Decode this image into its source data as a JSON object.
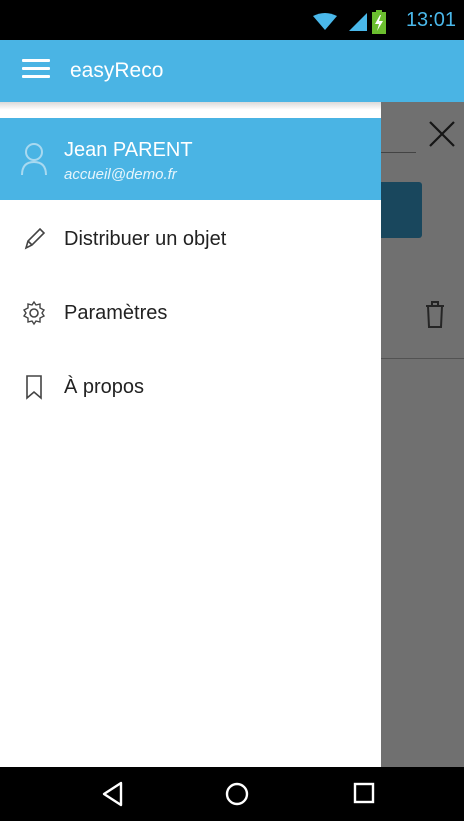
{
  "status_bar": {
    "time": "13:01",
    "icons": [
      "wifi-icon",
      "signal-icon",
      "battery-charging-icon"
    ],
    "clock_color": "#4ab8ea"
  },
  "app_bar": {
    "menu_icon": "hamburger-menu-icon",
    "title": "easyReco",
    "color": "#4ab4e4"
  },
  "drawer": {
    "header": {
      "avatar_icon": "person-icon",
      "name": "Jean PARENT",
      "email": "accueil@demo.fr"
    },
    "items": [
      {
        "icon": "pencil-icon",
        "label": "Distribuer un objet"
      },
      {
        "icon": "gear-icon",
        "label": "Paramètres"
      },
      {
        "icon": "bookmark-icon",
        "label": "À propos"
      }
    ]
  },
  "background": {
    "close_icon": "close-icon",
    "trash_icon": "trash-icon"
  },
  "nav_bar": {
    "buttons": [
      "back-icon",
      "home-icon",
      "recents-icon"
    ]
  }
}
